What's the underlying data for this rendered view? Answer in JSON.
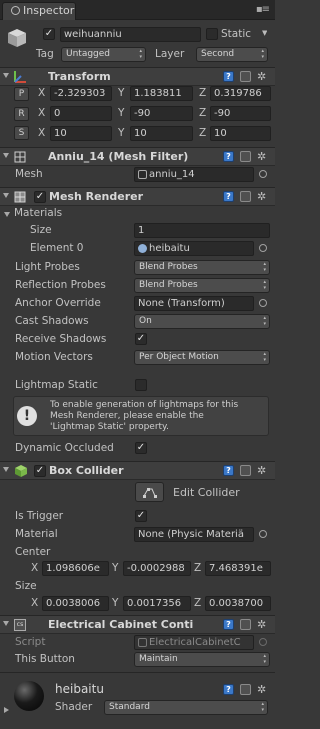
{
  "window": {
    "tab_label": "Inspector"
  },
  "object": {
    "active": true,
    "name": "weihuanniu",
    "static_label": "Static",
    "tag_label": "Tag",
    "tag_value": "Untagged",
    "layer_label": "Layer",
    "layer_value": "Second"
  },
  "transform": {
    "title": "Transform",
    "position": {
      "btn": "P",
      "x": "-2.329303",
      "y": "1.183811",
      "z": "0.319786"
    },
    "rotation": {
      "btn": "R",
      "x": "0",
      "y": "-90",
      "z": "-90"
    },
    "scale": {
      "btn": "S",
      "x": "10",
      "y": "10",
      "z": "10"
    },
    "axis_x": "X",
    "axis_y": "Y",
    "axis_z": "Z"
  },
  "mesh_filter": {
    "title": "Anniu_14 (Mesh Filter)",
    "mesh_label": "Mesh",
    "mesh_value": "anniu_14"
  },
  "mesh_renderer": {
    "title": "Mesh Renderer",
    "enabled": true,
    "materials_label": "Materials",
    "size_label": "Size",
    "size_value": "1",
    "element0_label": "Element 0",
    "element0_value": "heibaitu",
    "light_probes_label": "Light Probes",
    "light_probes_value": "Blend Probes",
    "reflection_probes_label": "Reflection Probes",
    "reflection_probes_value": "Blend Probes",
    "anchor_override_label": "Anchor Override",
    "anchor_override_value": "None (Transform)",
    "cast_shadows_label": "Cast Shadows",
    "cast_shadows_value": "On",
    "receive_shadows_label": "Receive Shadows",
    "receive_shadows": true,
    "motion_vectors_label": "Motion Vectors",
    "motion_vectors_value": "Per Object Motion",
    "lightmap_static_label": "Lightmap Static",
    "lightmap_static": false,
    "info_line1": "To enable generation of lightmaps for this",
    "info_line2": "Mesh Renderer, please enable the",
    "info_line3": "'Lightmap Static' property.",
    "dynamic_occluded_label": "Dynamic Occluded",
    "dynamic_occluded": true
  },
  "box_collider": {
    "title": "Box Collider",
    "enabled": true,
    "edit_collider_label": "Edit Collider",
    "is_trigger_label": "Is Trigger",
    "is_trigger": true,
    "material_label": "Material",
    "material_value": "None (Physic Materiä",
    "center_label": "Center",
    "center_x": "1.098606e",
    "center_y": "-0.0002988",
    "center_z": "7.468391e",
    "size_label": "Size",
    "size_x": "0.0038006",
    "size_y": "0.0017356",
    "size_z": "0.0038700"
  },
  "script_component": {
    "title": "Electrical Cabinet Conti",
    "script_label": "Script",
    "script_value": "ElectricalCabinetC",
    "this_button_label": "This Button",
    "this_button_value": "Maintain"
  },
  "material": {
    "name": "heibaitu",
    "shader_label": "Shader",
    "shader_value": "Standard"
  },
  "colors": {
    "background": "#383838",
    "header": "#3e3e3e",
    "field": "#2a2a2a",
    "accent": "#3b78c8"
  }
}
